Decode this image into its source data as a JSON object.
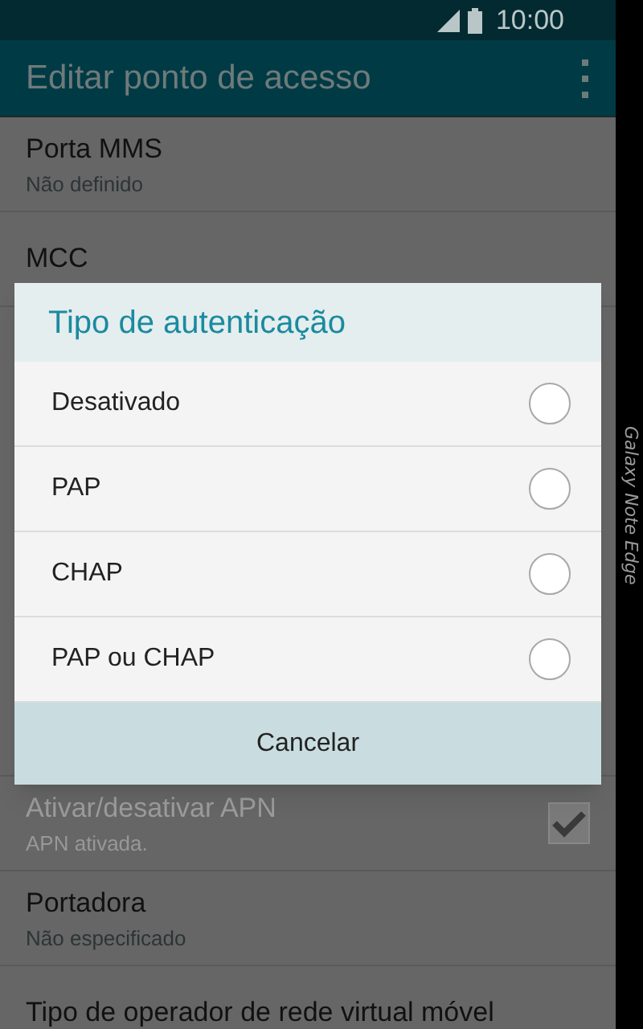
{
  "status_bar": {
    "time": "10:00"
  },
  "app_bar": {
    "title": "Editar ponto de acesso"
  },
  "settings": [
    {
      "kind": "text",
      "title": "Porta MMS",
      "summary": "Não definido",
      "disabled": false
    },
    {
      "kind": "text",
      "title": "MCC",
      "disabled": false
    },
    {
      "kind": "checkbox",
      "title": "Ativar/desativar APN",
      "summary": "APN ativada.",
      "disabled": true,
      "checked": true
    },
    {
      "kind": "text",
      "title": "Portadora",
      "summary": "Não especificado",
      "disabled": false
    },
    {
      "kind": "text",
      "title": "Tipo de operador de rede virtual móvel",
      "disabled": false
    }
  ],
  "dialog": {
    "title": "Tipo de autenticação",
    "options": [
      {
        "label": "Desativado",
        "selected": false
      },
      {
        "label": "PAP",
        "selected": false
      },
      {
        "label": "CHAP",
        "selected": false
      },
      {
        "label": "PAP ou CHAP",
        "selected": false
      }
    ],
    "button": "Cancelar"
  },
  "edge_panel": {
    "label": "Galaxy Note Edge"
  }
}
